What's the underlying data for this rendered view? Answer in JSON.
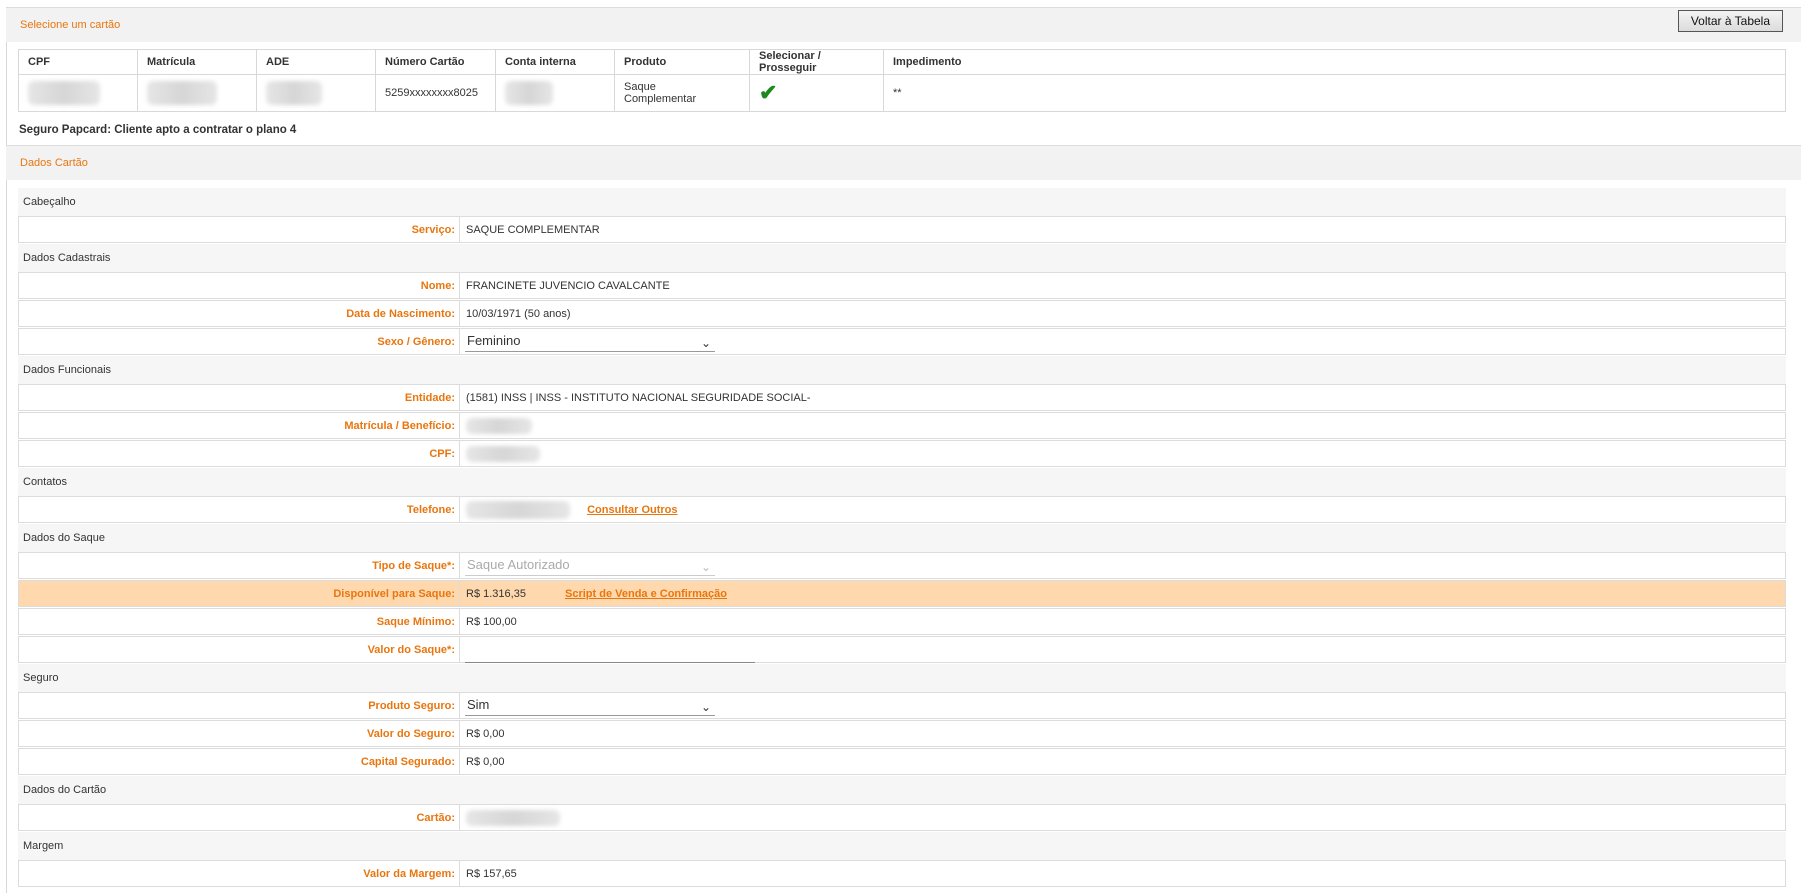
{
  "top_section": {
    "title": "Selecione um cartão",
    "back_button": "Voltar à Tabela"
  },
  "cards_table": {
    "headers": [
      "CPF",
      "Matrícula",
      "ADE",
      "Número Cartão",
      "Conta interna",
      "Produto",
      "Selecionar / Prosseguir",
      "Impedimento"
    ],
    "row": {
      "numero_cartao": "5259xxxxxxxx8025",
      "produto_line1": "Saque",
      "produto_line2": "Complementar",
      "select_icon": "check-icon",
      "impedimento": "**"
    }
  },
  "notice": "Seguro Papcard: Cliente apto a contratar o plano 4",
  "dados_cartao_section": {
    "title": "Dados Cartão"
  },
  "groups": {
    "cabecalho": "Cabeçalho",
    "dados_cadastrais": "Dados Cadastrais",
    "dados_funcionais": "Dados Funcionais",
    "contatos": "Contatos",
    "dados_saque": "Dados do Saque",
    "seguro": "Seguro",
    "dados_cartao": "Dados do Cartão",
    "margem": "Margem"
  },
  "fields": {
    "servico": {
      "label": "Serviço:",
      "value": "SAQUE COMPLEMENTAR"
    },
    "nome": {
      "label": "Nome:",
      "value": "FRANCINETE JUVENCIO CAVALCANTE"
    },
    "nascimento": {
      "label": "Data de Nascimento:",
      "value": "10/03/1971 (50 anos)"
    },
    "sexo": {
      "label": "Sexo / Gênero:",
      "value": "Feminino"
    },
    "entidade": {
      "label": "Entidade:",
      "value": "(1581) INSS | INSS - INSTITUTO NACIONAL SEGURIDADE SOCIAL-"
    },
    "matricula": {
      "label": "Matrícula / Benefício:"
    },
    "cpf": {
      "label": "CPF:"
    },
    "telefone": {
      "label": "Telefone:",
      "link": "Consultar Outros"
    },
    "tipo_saque": {
      "label": "Tipo de Saque*:",
      "value": "Saque Autorizado"
    },
    "disponivel": {
      "label": "Disponível para Saque:",
      "value": "R$ 1.316,35",
      "link": "Script de Venda e Confirmação"
    },
    "saque_minimo": {
      "label": "Saque Mínimo:",
      "value": "R$ 100,00"
    },
    "valor_saque": {
      "label": "Valor do Saque*:",
      "value": ""
    },
    "produto_seguro": {
      "label": "Produto Seguro:",
      "value": "Sim"
    },
    "valor_seguro": {
      "label": "Valor do Seguro:",
      "value": "R$ 0,00"
    },
    "capital_segurado": {
      "label": "Capital Segurado:",
      "value": "R$ 0,00"
    },
    "cartao": {
      "label": "Cartão:"
    },
    "valor_margem": {
      "label": "Valor da Margem:",
      "value": "R$ 157,65"
    }
  },
  "colors": {
    "accent": "#e8760f",
    "highlight_row": "#ffd9ad",
    "check": "#1c8a1c"
  }
}
